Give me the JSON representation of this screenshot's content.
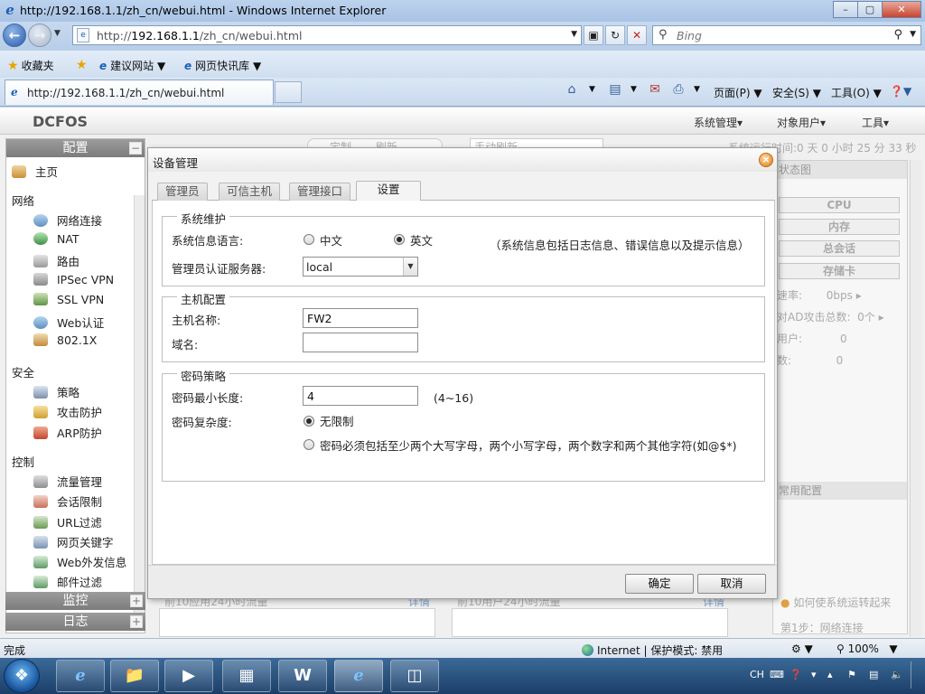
{
  "window": {
    "title": "http://192.168.1.1/zh_cn/webui.html - Windows Internet Explorer",
    "buttons": {
      "minimize": "–",
      "maximize": "▢",
      "close": "✕"
    }
  },
  "addressbar": {
    "url_prefix": "http://",
    "url_host": "192.168.1.1",
    "url_path": "/zh_cn/webui.html",
    "search_placeholder": "Bing"
  },
  "favorites": {
    "favorites_label": "收藏夹",
    "suggested_sites": "建议网站",
    "web_slice": "网页快讯库"
  },
  "tab": {
    "title": "http://192.168.1.1/zh_cn/webui.html"
  },
  "commandbar": {
    "page": "页面(P)",
    "safety": "安全(S)",
    "tools": "工具(O)"
  },
  "app": {
    "brand": "DCFOS",
    "topmenu": [
      "系统管理",
      "对象用户",
      "工具"
    ],
    "uptime": "系统运行时间:0 天 0 小时 25 分 33 秒",
    "behind_fields": [
      "定制",
      "刷新",
      "手动刷新"
    ]
  },
  "sidebar": {
    "config_header": "配置",
    "home": "主页",
    "groups": {
      "network": "网络",
      "security": "安全",
      "control": "控制"
    },
    "network_items": [
      "网络连接",
      "NAT",
      "路由",
      "IPSec VPN",
      "SSL VPN",
      "Web认证",
      "802.1X"
    ],
    "security_items": [
      "策略",
      "攻击防护",
      "ARP防护"
    ],
    "control_items": [
      "流量管理",
      "会话限制",
      "URL过滤",
      "网页关键字",
      "Web外发信息",
      "邮件过滤"
    ],
    "monitor_header": "监控",
    "log_header": "日志",
    "collapse_symbol": "−",
    "expand_symbol": "+"
  },
  "rightpanel": {
    "status_title": "状态图",
    "gauges": [
      "CPU",
      "内存",
      "总会话",
      "存储卡"
    ],
    "rows": [
      {
        "label": "速率:",
        "value": "0bps"
      },
      {
        "label": "对AD攻击总数:",
        "value": "0个"
      },
      {
        "label": "用户:",
        "value": "0"
      },
      {
        "label": "数:",
        "value": "0"
      }
    ],
    "common_config": "常用配置",
    "howto": "如何使系统运转起来",
    "step1": "第1步：网络连接"
  },
  "bottom": {
    "top10_apps": "前10应用24小时流量",
    "top10_users": "前10用户24小时流量",
    "detail": "详情"
  },
  "dialog": {
    "title": "设备管理",
    "tabs": [
      "管理员",
      "可信主机",
      "管理接口",
      "设置"
    ],
    "active_tab": "设置",
    "system_maintenance": {
      "legend": "系统维护",
      "lang_label": "系统信息语言:",
      "lang_zh": "中文",
      "lang_en": "英文",
      "lang_selected": "英文",
      "lang_note": "（系统信息包括日志信息、错误信息以及提示信息）",
      "auth_label": "管理员认证服务器:",
      "auth_value": "local"
    },
    "host_config": {
      "legend": "主机配置",
      "hostname_label": "主机名称:",
      "hostname_value": "FW2",
      "domain_label": "域名:",
      "domain_value": ""
    },
    "password_policy": {
      "legend": "密码策略",
      "minlen_label": "密码最小长度:",
      "minlen_value": "4",
      "minlen_range": "(4~16)",
      "complexity_label": "密码复杂度:",
      "opt_unlimited": "无限制",
      "opt_strict": "密码必须包括至少两个大写字母，两个小写字母，两个数字和两个其他字符(如@$*)",
      "complexity_selected": "无限制"
    },
    "ok": "确定",
    "cancel": "取消"
  },
  "statusbar": {
    "left": "完成",
    "zone": "Internet | 保护模式: 禁用",
    "zoom": "100%"
  },
  "taskbar": {
    "tray_lang": "CH"
  }
}
